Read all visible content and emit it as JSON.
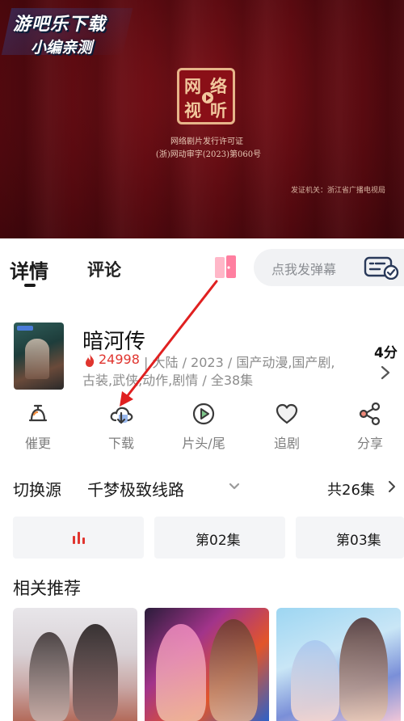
{
  "video": {
    "watermark_line1": "游吧乐下载",
    "watermark_line2": "小编亲测",
    "seal_chars": [
      "网",
      "络",
      "视",
      "听"
    ],
    "license_line1": "网络剧片发行许可证",
    "license_line2": "(浙)网动审字(2023)第060号",
    "license_line3": "发证机关：浙江省广播电视局"
  },
  "tabs": {
    "detail": "详情",
    "comments": "评论"
  },
  "danmaku": {
    "placeholder": "点我发弹幕"
  },
  "show": {
    "title": "暗河传",
    "heat": "24998",
    "meta_line1": "| 大陆 / 2023 / 国产动漫,国产剧,",
    "meta_line2": "古装,武侠,动作,剧情 / 全38集",
    "score": "4分"
  },
  "actions": [
    {
      "label": "催更",
      "icon": "bell-icon"
    },
    {
      "label": "下载",
      "icon": "cloud-download-icon"
    },
    {
      "label": "片头/尾",
      "icon": "play-circle-icon"
    },
    {
      "label": "追剧",
      "icon": "heart-icon"
    },
    {
      "label": "分享",
      "icon": "share-icon"
    }
  ],
  "source": {
    "label": "切换源",
    "line": "千梦极致线路",
    "total": "共26集"
  },
  "episodes": [
    {
      "label": "",
      "playing": true
    },
    {
      "label": "第02集"
    },
    {
      "label": "第03集"
    }
  ],
  "recommend": {
    "title": "相关推荐"
  },
  "colors": {
    "accent_red": "#e0352f",
    "video_bg": "#5a0a10",
    "annotation_arrow": "#e02020"
  }
}
